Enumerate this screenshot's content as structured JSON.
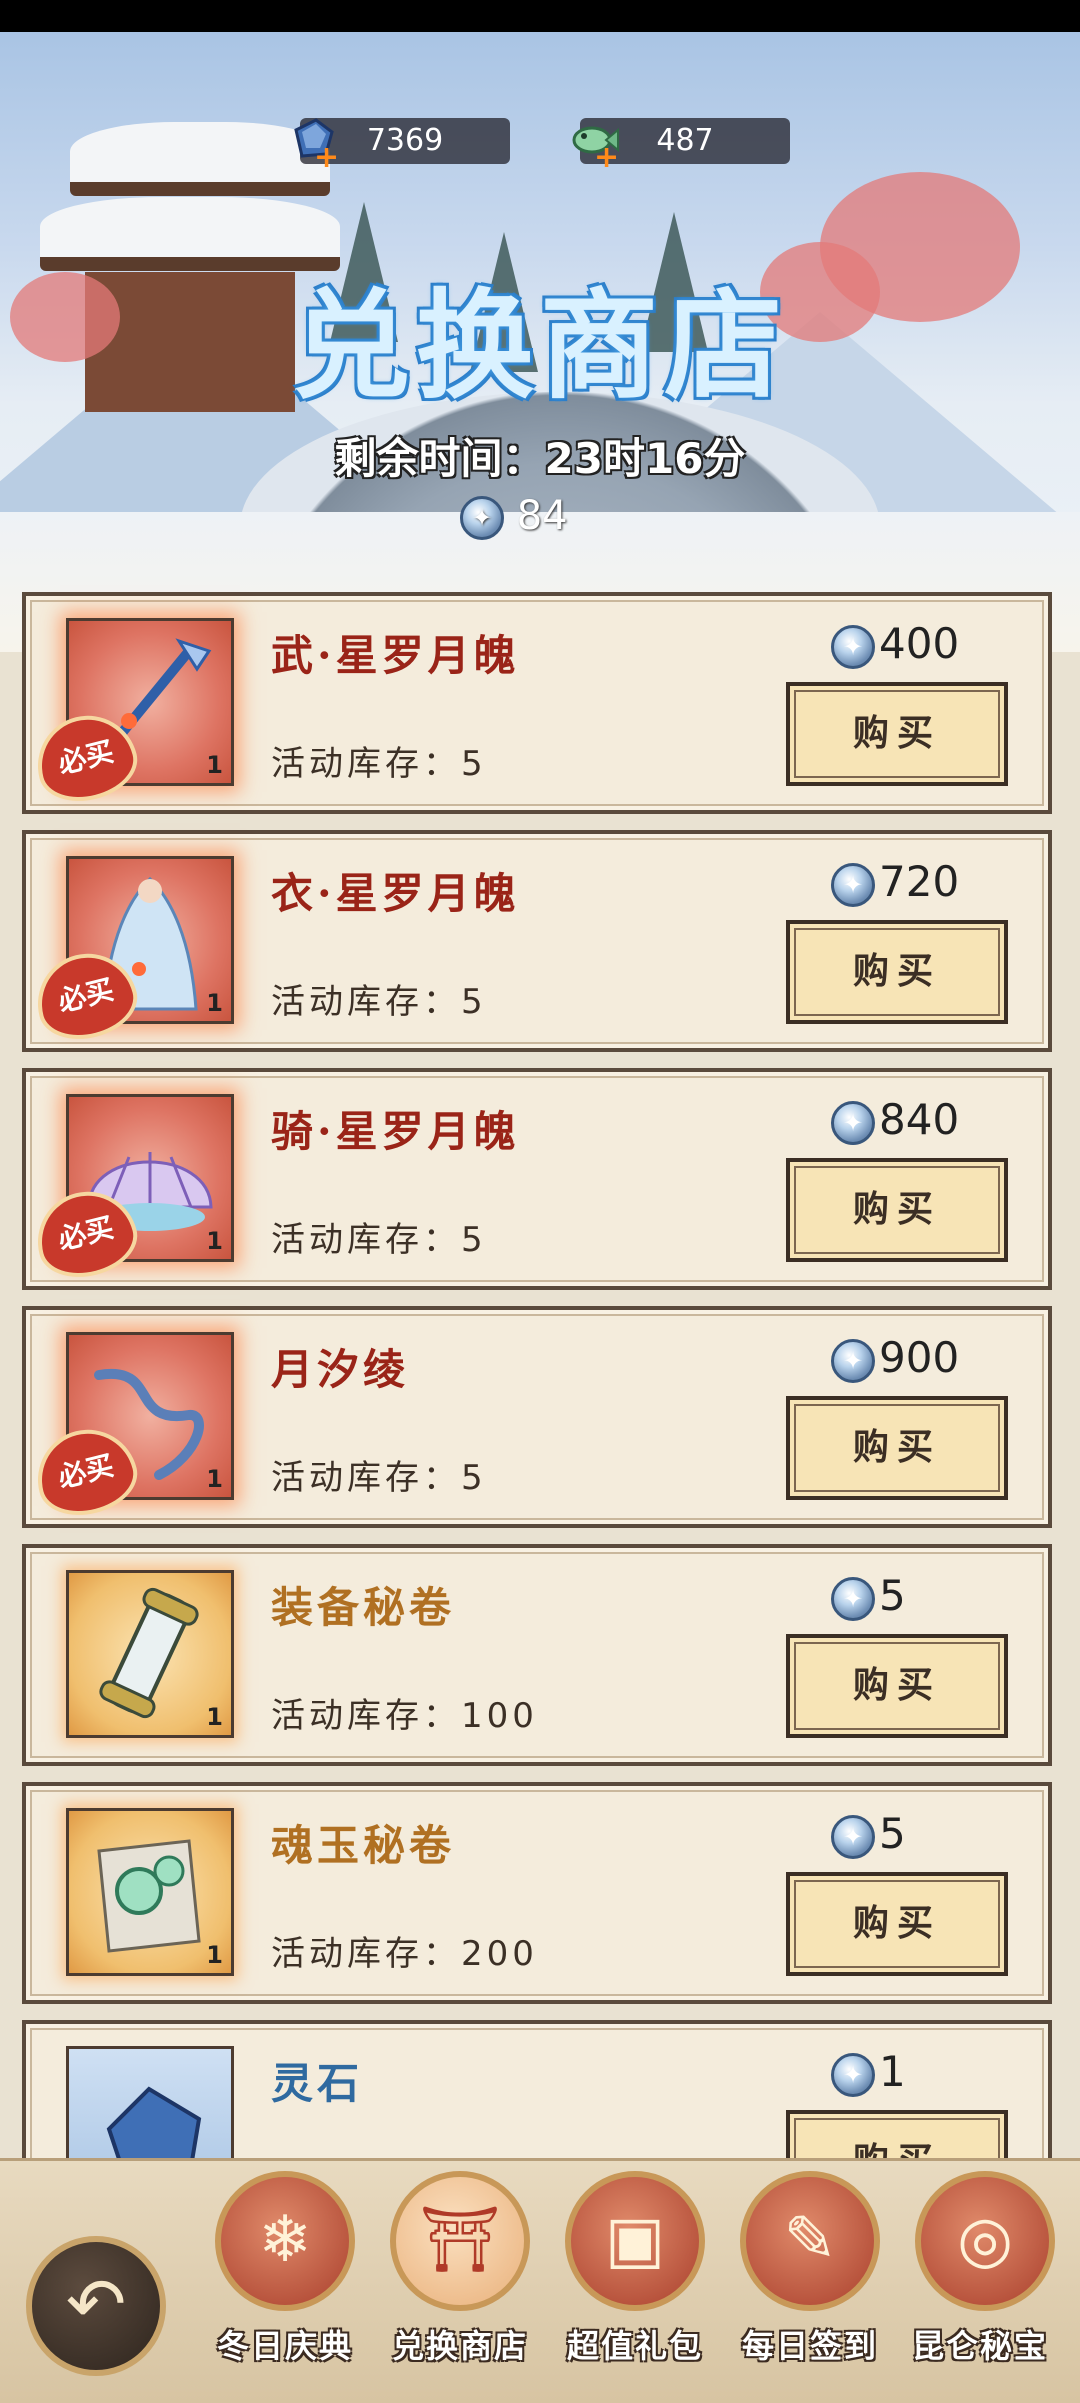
{
  "header": {
    "currency_1": "7369",
    "currency_2": "487",
    "title": "兑换商店",
    "timer_label": "剩余时间：",
    "timer_value": "23时16分",
    "token_count": "84"
  },
  "items": [
    {
      "name": "武·星罗月魄",
      "stock_label": "活动库存：",
      "stock": "5",
      "price": "400",
      "buy": "购买",
      "qty": "1",
      "badge": "必买",
      "rarity": "red"
    },
    {
      "name": "衣·星罗月魄",
      "stock_label": "活动库存：",
      "stock": "5",
      "price": "720",
      "buy": "购买",
      "qty": "1",
      "badge": "必买",
      "rarity": "red"
    },
    {
      "name": "骑·星罗月魄",
      "stock_label": "活动库存：",
      "stock": "5",
      "price": "840",
      "buy": "购买",
      "qty": "1",
      "badge": "必买",
      "rarity": "red"
    },
    {
      "name": "月汐绫",
      "stock_label": "活动库存：",
      "stock": "5",
      "price": "900",
      "buy": "购买",
      "qty": "1",
      "badge": "必买",
      "rarity": "red"
    },
    {
      "name": "装备秘卷",
      "stock_label": "活动库存：",
      "stock": "100",
      "price": "5",
      "buy": "购买",
      "qty": "1",
      "rarity": "gold"
    },
    {
      "name": "魂玉秘卷",
      "stock_label": "活动库存：",
      "stock": "200",
      "price": "5",
      "buy": "购买",
      "qty": "1",
      "rarity": "gold"
    },
    {
      "name": "灵石",
      "price": "1",
      "buy": "购买",
      "rarity": "blue"
    }
  ],
  "nav": {
    "tabs": [
      {
        "label": "冬日庆典",
        "icon": "snowflake-icon"
      },
      {
        "label": "兑换商店",
        "icon": "pavilion-icon",
        "active": true
      },
      {
        "label": "超值礼包",
        "icon": "treasure-chest-icon"
      },
      {
        "label": "每日签到",
        "icon": "calendar-sign-icon"
      },
      {
        "label": "昆仑秘宝",
        "icon": "swirl-treasure-icon"
      }
    ]
  }
}
